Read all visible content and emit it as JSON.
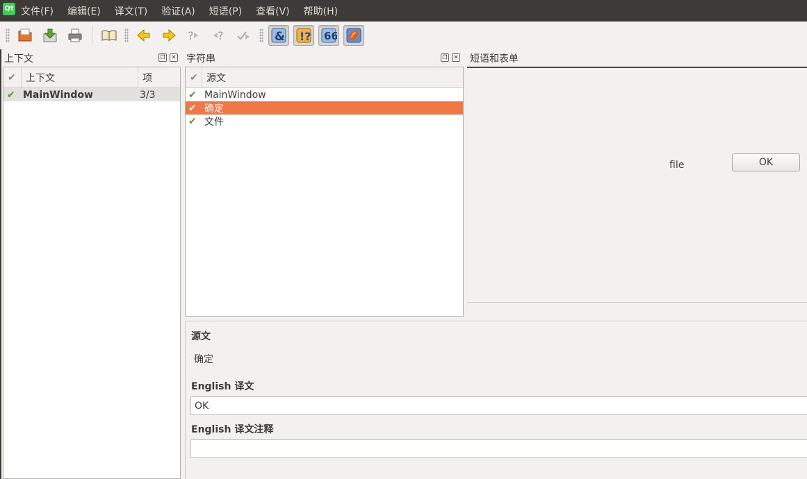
{
  "menubar": {
    "logo": "Qt",
    "items": [
      "文件(F)",
      "编辑(E)",
      "译文(T)",
      "验证(A)",
      "短语(P)",
      "查看(V)",
      "帮助(H)"
    ]
  },
  "toolbar": {
    "icons": [
      "open-icon",
      "save-icon",
      "print-icon",
      "phrasebook-icon",
      "prev-arrow-icon",
      "next-arrow-icon",
      "prev-unfinished-icon",
      "next-unfinished-icon",
      "done-next-icon",
      "accelerator-check-icon",
      "punctuation-check-icon",
      "phrase-match-icon",
      "placeholder-check-icon"
    ]
  },
  "context_dock": {
    "title": "上下文",
    "columns": [
      "上下文",
      "项"
    ],
    "rows": [
      {
        "name": "MainWindow",
        "count": "3/3"
      }
    ]
  },
  "strings_dock": {
    "title": "字符串",
    "column": "源文",
    "rows": [
      "MainWindow",
      "确定",
      "文件"
    ]
  },
  "phrases_dock": {
    "title": "短语和表单",
    "form_preview": {
      "label": "file",
      "button": "OK"
    }
  },
  "editor": {
    "source_label": "源文",
    "source_text": "确定",
    "translation_label": "English 译文",
    "translation_value": "OK",
    "comment_label": "English 译文注释",
    "comment_value": ""
  }
}
